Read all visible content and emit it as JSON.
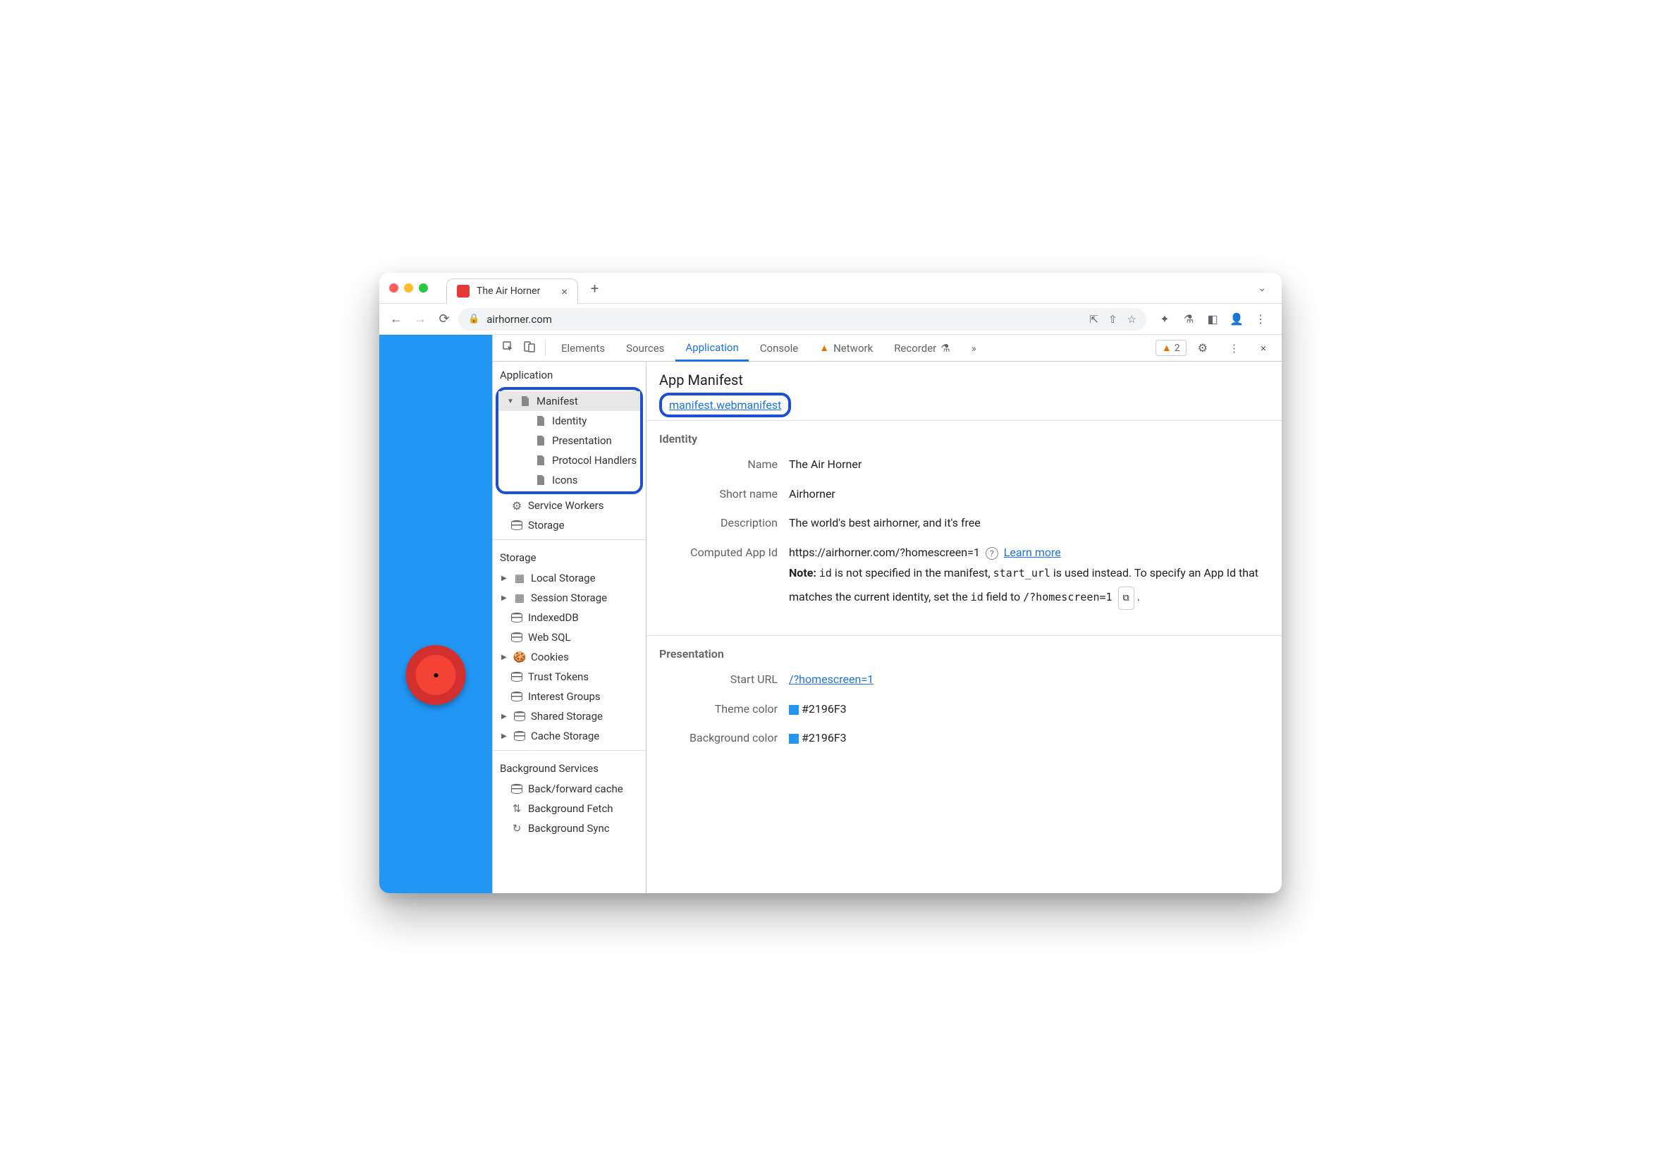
{
  "window": {
    "tab_title": "The Air Horner",
    "url": "airhorner.com"
  },
  "devtools": {
    "tabs": [
      "Elements",
      "Sources",
      "Application",
      "Console",
      "Network",
      "Recorder"
    ],
    "active_tab": "Application",
    "warning_count": "2"
  },
  "sidebar": {
    "groups": {
      "application": {
        "title": "Application",
        "manifest": "Manifest",
        "manifest_children": [
          "Identity",
          "Presentation",
          "Protocol Handlers",
          "Icons"
        ],
        "service_workers": "Service Workers",
        "storage": "Storage"
      },
      "storage": {
        "title": "Storage",
        "items": [
          "Local Storage",
          "Session Storage",
          "IndexedDB",
          "Web SQL",
          "Cookies",
          "Trust Tokens",
          "Interest Groups",
          "Shared Storage",
          "Cache Storage"
        ]
      },
      "background": {
        "title": "Background Services",
        "items": [
          "Back/forward cache",
          "Background Fetch",
          "Background Sync"
        ]
      }
    }
  },
  "panel": {
    "title": "App Manifest",
    "manifest_link": "manifest.webmanifest",
    "identity": {
      "section_title": "Identity",
      "name_label": "Name",
      "name_value": "The Air Horner",
      "short_name_label": "Short name",
      "short_name_value": "Airhorner",
      "description_label": "Description",
      "description_value": "The world's best airhorner, and it's free",
      "appid_label": "Computed App Id",
      "appid_value": "https://airhorner.com/?homescreen=1",
      "learn_more": "Learn more",
      "note_prefix": "Note:",
      "note_text1": " is not specified in the manifest, ",
      "note_text2": " is used instead. To specify an App Id that matches the current identity, set the ",
      "note_text3": " field to ",
      "code_id": "id",
      "code_start_url": "start_url",
      "code_suggest": "/?homescreen=1"
    },
    "presentation": {
      "section_title": "Presentation",
      "start_url_label": "Start URL",
      "start_url_value": "/?homescreen=1",
      "theme_label": "Theme color",
      "theme_value": "#2196F3",
      "bg_label": "Background color",
      "bg_value": "#2196F3"
    }
  }
}
